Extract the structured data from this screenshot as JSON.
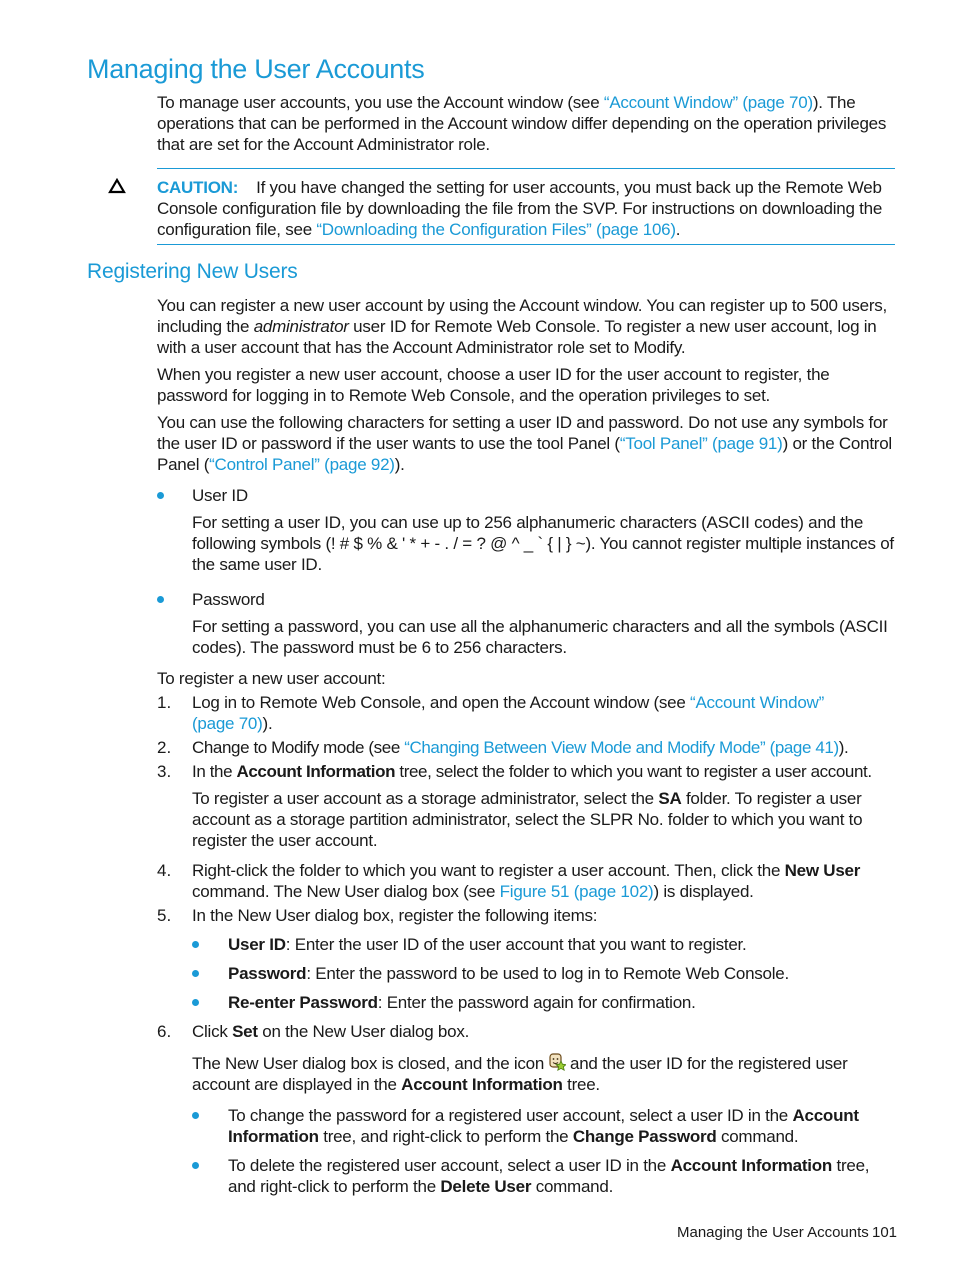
{
  "page": {
    "title": "Managing the User Accounts",
    "intro": {
      "t1": "To manage user accounts, you use the Account window (see ",
      "link1": "“Account Window” (page 70)",
      "t2": "). The operations that can be performed in the Account window differ depending on the operation privileges that are set for the Account Administrator role."
    },
    "caution": {
      "icon": "warning-triangle-icon",
      "label": "CAUTION:",
      "t1": "If you have changed the setting for user accounts, you must back up the Remote Web Console configuration file by downloading the file from the SVP. For instructions on downloading the configuration file, see ",
      "link1": "“Downloading the Configuration Files” (page 106)",
      "t2": "."
    },
    "section_title": "Registering New Users",
    "p1": {
      "t1": "You can register a new user account by using the Account window. You can register up to 500 users, including the ",
      "italic": "administrator",
      "t2": " user ID for Remote Web Console. To register a new user account, log in with a user account that has the Account Administrator role set to Modify."
    },
    "p2": "When you register a new user account, choose a user ID for the user account to register, the password for logging in to Remote Web Console, and the operation privileges to set.",
    "p3": {
      "t1": "You can use the following characters for setting a user ID and password. Do not use any symbols for the user ID or password if the user wants to use the tool Panel (",
      "link1": "“Tool Panel” (page 91)",
      "t2": ") or the Control Panel (",
      "link2": "“Control Panel” (page 92)",
      "t3": ")."
    },
    "char_rules": [
      {
        "label": "User ID",
        "desc": "For setting a user ID, you can use up to 256 alphanumeric characters (ASCII codes) and the following symbols (! # $ % & ' * + - . / = ? @ ^ _ ` { | } ~). You cannot register multiple instances of the same user ID."
      },
      {
        "label": "Password",
        "desc": "For setting a password, you can use all the alphanumeric characters and all the symbols (ASCII codes). The password must be 6 to 256 characters."
      }
    ],
    "steps_intro": "To register a new user account:",
    "steps": [
      {
        "num": "1.",
        "t1": "Log in to Remote Web Console, and open the Account window (see ",
        "link1a": "“Account Window”",
        "link1b": "(page 70)",
        "t2": ")."
      },
      {
        "num": "2.",
        "t1": "Change to Modify mode (see ",
        "link1": "“Changing Between View Mode and Modify Mode” (page 41)",
        "t2": ")."
      },
      {
        "num": "3.",
        "t1": "In the ",
        "b1": "Account Information",
        "t2": " tree, select the folder to which you want to register a user account.",
        "sub": {
          "t1": "To register a user account as a storage administrator, select the ",
          "b1": "SA",
          "t2": " folder. To register a user account as a storage partition administrator, select the SLPR No. folder to which you want to register the user account."
        }
      },
      {
        "num": "4.",
        "t1": "Right-click the folder to which you want to register a user account. Then, click the ",
        "b1": "New User",
        "t2": " command. The New User dialog box (see ",
        "link1": "Figure 51 (page 102)",
        "t3": ") is displayed."
      },
      {
        "num": "5.",
        "t1": "In the New User dialog box, register the following items:",
        "items": [
          {
            "b": "User ID",
            "t": ": Enter the user ID of the user account that you want to register."
          },
          {
            "b": "Password",
            "t": ": Enter the password to be used to log in to Remote Web Console."
          },
          {
            "b": "Re-enter Password",
            "t": ": Enter the password again for confirmation."
          }
        ]
      },
      {
        "num": "6.",
        "t1": "Click ",
        "b1": "Set",
        "t2": " on the New User dialog box.",
        "result": {
          "t1": "The New User dialog box is closed, and the icon ",
          "icon": "new-user-icon",
          "t2": " and the user ID for the registered user account are displayed in the ",
          "b1": "Account Information",
          "t3": " tree."
        },
        "notes": [
          {
            "t1": "To change the password for a registered user account, select a user ID in the ",
            "b1": "Account Information",
            "t2": " tree, and right-click to perform the ",
            "b2": "Change Password",
            "t3": " command."
          },
          {
            "t1": "To delete the registered user account, select a user ID in the ",
            "b1": "Account Information",
            "t2": " tree, and right-click to perform the ",
            "b2": "Delete User",
            "t3": " command."
          }
        ]
      }
    ],
    "footer": {
      "section": "Managing the User Accounts",
      "page_number": "101"
    }
  },
  "colors": {
    "accent": "#1a9ad6",
    "text": "#1a1a1a"
  }
}
